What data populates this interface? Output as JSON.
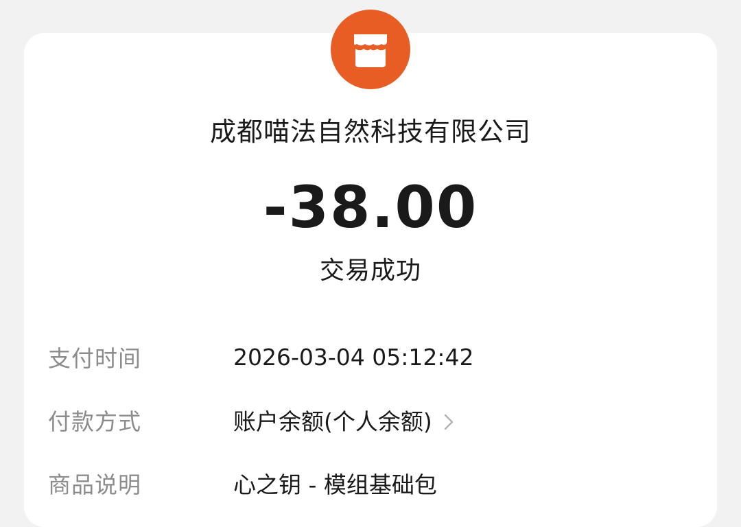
{
  "merchant": {
    "icon": "store-icon",
    "icon_color": "#e85d23",
    "name": "成都喵法自然科技有限公司"
  },
  "transaction": {
    "amount": "-38.00",
    "status": "交易成功"
  },
  "details": [
    {
      "label": "支付时间",
      "value": "2026-03-04 05:12:42"
    },
    {
      "label": "付款方式",
      "value": "账户余额(个人余额)",
      "icon": "chevron-right-icon"
    },
    {
      "label": "商品说明",
      "value": "心之钥 - 模组基础包"
    }
  ]
}
